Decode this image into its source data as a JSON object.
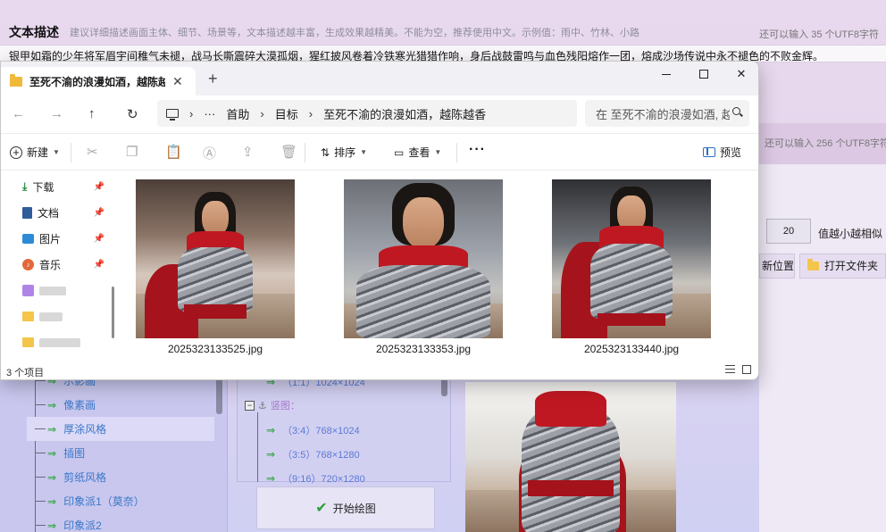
{
  "background_app": {
    "section_title": "文本描述",
    "section_hint": "建议详细描述画面主体、细节、场景等，文本描述越丰富，生成效果越精美。不能为空，推荐使用中文。示例值：雨中、竹林、小路",
    "remaining_top": "还可以输入 35 个UTF8字符",
    "prompt_text": "银甲如霜的少年将军眉宇间稚气未褪，战马长嘶震碎大漠孤烟，猩红披风卷着冷铁寒光猎猎作响，身后战鼓雷鸣与血色残阳熔作一团，熔成沙场传说中永不褪色的不败金辉。",
    "remaining_second": "还可以输入 256 个UTF8字符",
    "similarity_value": "20",
    "similarity_label": "值越小越相似",
    "position_button": "新位置",
    "open_folder_button": "打开文件夹",
    "style_list": [
      "示影画",
      "像素画",
      "厚涂风格",
      "插图",
      "剪纸风格",
      "印象派1（莫奈）",
      "印象派2"
    ],
    "style_selected_index": 2,
    "ratio_list": [
      {
        "label": "（1:1）1024×1024"
      },
      {
        "label": "竖图：",
        "group": true
      },
      {
        "label": "（3:4）768×1024"
      },
      {
        "label": "（3:5）768×1280"
      },
      {
        "label": "（9:16）720×1280"
      }
    ],
    "start_button": "开始绘图"
  },
  "explorer": {
    "tab_title": "至死不渝的浪漫如酒，越陈越香",
    "new_tab_symbol": "+",
    "window_controls": {
      "minimize": "—",
      "maximize": "□",
      "close": "✕"
    },
    "nav": {
      "back": "←",
      "forward": "→",
      "up": "↑",
      "refresh": "↻"
    },
    "address": {
      "ellipsis": "···",
      "crumbs": [
        "首助",
        "目标",
        "至死不渝的浪漫如酒，越陈越香"
      ]
    },
    "search_placeholder": "在 至死不渝的浪漫如酒, 越陈越香 中搜索",
    "toolbar": {
      "new_label": "新建",
      "sort_label": "排序",
      "view_label": "查看",
      "more_label": "···",
      "preview_label": "预览"
    },
    "sidebar": [
      {
        "label": "下载",
        "icon": "download-icon",
        "pinned": true
      },
      {
        "label": "文档",
        "icon": "document-icon",
        "pinned": true
      },
      {
        "label": "图片",
        "icon": "picture-icon",
        "pinned": true
      },
      {
        "label": "音乐",
        "icon": "music-icon",
        "pinned": true
      }
    ],
    "files": [
      {
        "name": "2025323133525.jpg"
      },
      {
        "name": "2025323133353.jpg"
      },
      {
        "name": "2025323133440.jpg"
      }
    ],
    "status_count": "3 个项目"
  },
  "colors": {
    "accent_blue": "#2b6fc7",
    "armor_red": "#c01822",
    "folder_yellow": "#f0b93a",
    "list_item_blue": "#3a77c8",
    "arrow_green": "#3aa84a"
  }
}
